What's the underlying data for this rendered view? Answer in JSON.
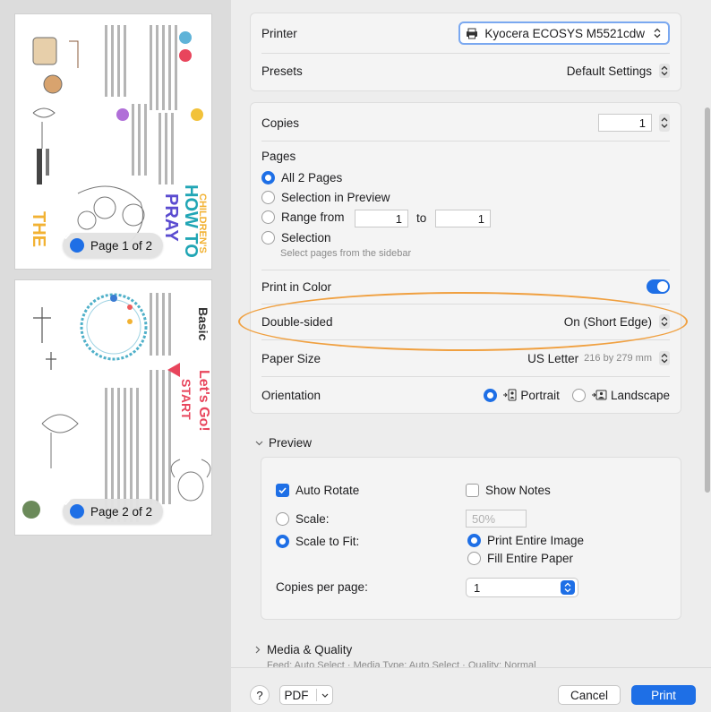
{
  "sidebar": {
    "pages": [
      {
        "badge": "Page 1 of 2"
      },
      {
        "badge": "Page 2 of 2"
      }
    ]
  },
  "printer": {
    "label": "Printer",
    "value": "Kyocera ECOSYS M5521cdw"
  },
  "presets": {
    "label": "Presets",
    "value": "Default Settings"
  },
  "copies": {
    "label": "Copies",
    "value": "1"
  },
  "pages": {
    "label": "Pages",
    "all": "All 2 Pages",
    "selection_preview": "Selection in Preview",
    "range_from": "Range from",
    "range_start": "1",
    "range_to": "to",
    "range_end": "1",
    "selection": "Selection",
    "selection_hint": "Select pages from the sidebar"
  },
  "print_in_color": {
    "label": "Print in Color",
    "enabled": true
  },
  "double_sided": {
    "label": "Double-sided",
    "value": "On (Short Edge)"
  },
  "paper_size": {
    "label": "Paper Size",
    "value": "US Letter",
    "dims": "216 by 279 mm"
  },
  "orientation": {
    "label": "Orientation",
    "portrait": "Portrait",
    "landscape": "Landscape",
    "selected": "Portrait"
  },
  "preview": {
    "header": "Preview",
    "auto_rotate": "Auto Rotate",
    "show_notes": "Show Notes",
    "scale": "Scale:",
    "scale_value": "50%",
    "scale_to_fit": "Scale to Fit:",
    "print_entire_image": "Print Entire Image",
    "fill_entire_paper": "Fill Entire Paper",
    "copies_per_page": "Copies per page:",
    "copies_per_page_value": "1"
  },
  "media_quality": {
    "header": "Media & Quality",
    "summary": "Feed: Auto Select · Media Type: Auto Select · Quality: Normal"
  },
  "bottom": {
    "help": "?",
    "pdf": "PDF",
    "cancel": "Cancel",
    "print": "Print"
  },
  "colors": {
    "accent": "#1e6fe6",
    "highlight": "#f0a040"
  },
  "icons": [
    "printer-icon",
    "chevron-updown-icon",
    "chevron-down-icon",
    "chevron-right-icon",
    "checkmark-icon",
    "portrait-icon",
    "landscape-icon",
    "help-icon"
  ]
}
